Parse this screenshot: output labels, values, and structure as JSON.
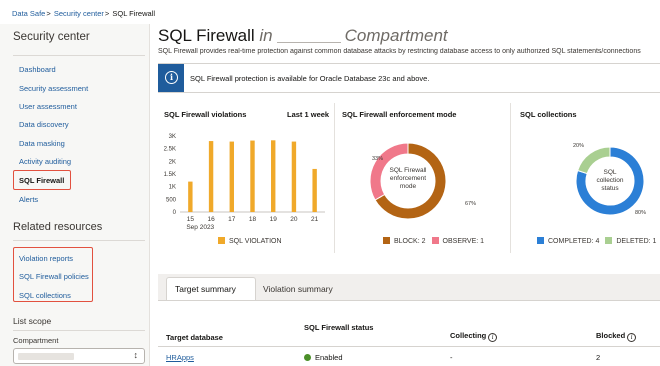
{
  "breadcrumb": {
    "items": [
      "Data Safe",
      "Security center",
      "SQL Firewall"
    ],
    "separator": ">"
  },
  "sidebar": {
    "title": "Security center",
    "nav": [
      {
        "label": "Dashboard"
      },
      {
        "label": "Security assessment"
      },
      {
        "label": "User assessment"
      },
      {
        "label": "Data discovery"
      },
      {
        "label": "Data masking"
      },
      {
        "label": "Activity auditing"
      },
      {
        "label": "SQL Firewall",
        "active": true
      },
      {
        "label": "Alerts"
      }
    ],
    "related_title": "Related resources",
    "related": [
      {
        "label": "Violation reports"
      },
      {
        "label": "SQL Firewall policies"
      },
      {
        "label": "SQL collections"
      }
    ],
    "list_scope": "List scope",
    "compartment_label": "Compartment",
    "compartment_value": ""
  },
  "header": {
    "title_main": "SQL Firewall",
    "title_in": "in",
    "title_scope": "Compartment",
    "description": "SQL Firewall provides real-time protection against common database attacks by restricting database access to only authorized SQL statements/connections"
  },
  "info_banner": {
    "icon": "info-icon",
    "text": "SQL Firewall protection is available for Oracle Database 23c and above."
  },
  "colors": {
    "accent": "#1f5c9c",
    "violation": "#f0a92a",
    "block": "#b36414",
    "observe": "#f0788a",
    "completed": "#2b7fd6",
    "deleted": "#a9cf91",
    "enabled": "#4b8f29",
    "highlight": "#e2513f"
  },
  "chart_data": [
    {
      "type": "bar",
      "title": "SQL Firewall violations",
      "period": "Last 1 week",
      "categories": [
        "15",
        "16",
        "17",
        "18",
        "19",
        "20",
        "21"
      ],
      "x_sublabel": "Sep 2023",
      "series": [
        {
          "name": "SQL VIOLATION",
          "values": [
            1200,
            2800,
            2780,
            2820,
            2830,
            2780,
            1700
          ]
        }
      ],
      "yticks": [
        "0",
        "500",
        "1K",
        "1.5K",
        "2K",
        "2.5K",
        "3K"
      ],
      "ylim": [
        0,
        3000
      ]
    },
    {
      "type": "pie",
      "title": "SQL Firewall enforcement mode",
      "center_label": [
        "SQL Firewall",
        "enforcement",
        "mode"
      ],
      "slices": [
        {
          "name": "BLOCK",
          "value": 2,
          "percent": 67
        },
        {
          "name": "OBSERVE",
          "value": 1,
          "percent": 33
        }
      ]
    },
    {
      "type": "pie",
      "title": "SQL collections",
      "center_label": [
        "SQL",
        "collection",
        "status"
      ],
      "slices": [
        {
          "name": "COMPLETED",
          "value": 4,
          "percent": 80
        },
        {
          "name": "DELETED",
          "value": 1,
          "percent": 20
        }
      ]
    }
  ],
  "tabs": [
    {
      "label": "Target summary",
      "active": true
    },
    {
      "label": "Violation summary"
    }
  ],
  "table": {
    "columns": [
      "Target database",
      "SQL Firewall status",
      "Collecting",
      "Blocked"
    ],
    "rows": [
      {
        "target": "HRApps",
        "status": "Enabled",
        "collecting": "-",
        "blocked": "2"
      }
    ]
  }
}
